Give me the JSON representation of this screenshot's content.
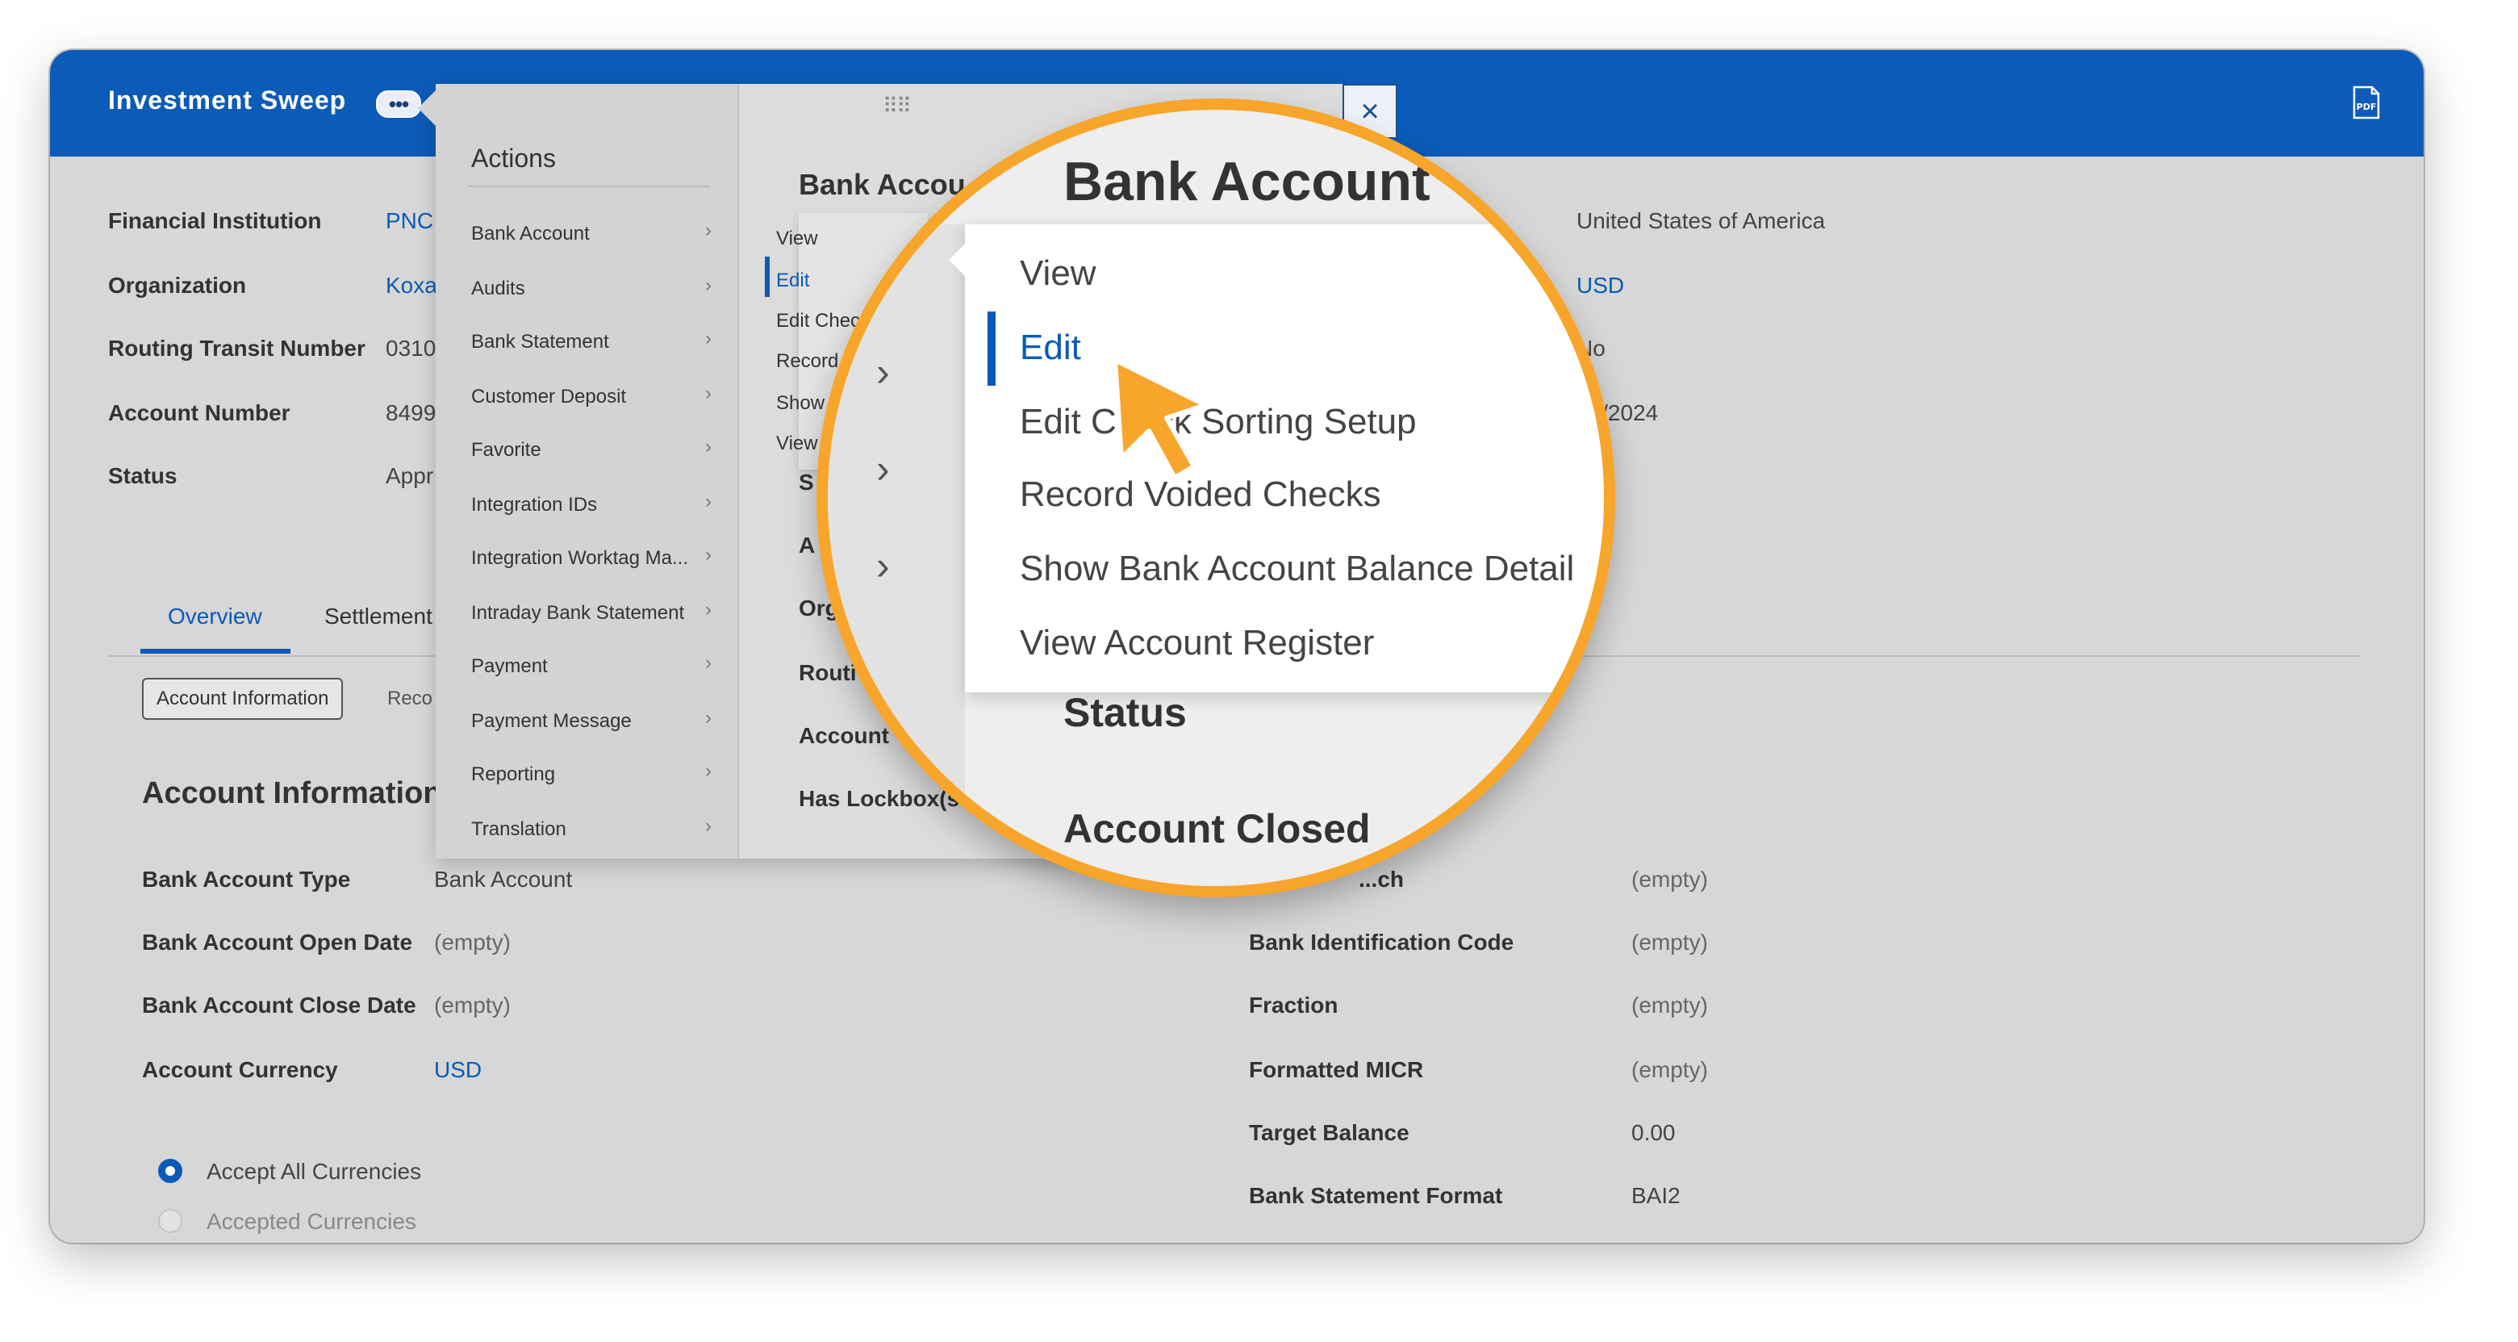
{
  "window": {
    "title": "Investment Sweep",
    "menu_dots": "•••",
    "pdf_icon": "pdf-icon"
  },
  "fields_left": [
    {
      "label": "Financial Institution",
      "value": "PNC",
      "link": true
    },
    {
      "label": "Organization",
      "value": "Koxa",
      "link": true
    },
    {
      "label": "Routing Transit Number",
      "value": "0310",
      "link": false
    },
    {
      "label": "Account Number",
      "value": "8499",
      "link": false
    },
    {
      "label": "Status",
      "value": "Appr",
      "link": false
    }
  ],
  "fields_right": [
    {
      "value": "United States of America",
      "link": false
    },
    {
      "value": "USD",
      "link": true
    },
    {
      "value": "No",
      "link": false
    },
    {
      "value": "08/2024",
      "link": false
    }
  ],
  "tabs": [
    {
      "label": "Overview",
      "active": true
    },
    {
      "label": "Settlement"
    }
  ],
  "subtabs": {
    "account_information": "Account Information",
    "reco": "Reco"
  },
  "section_title": "Account Information",
  "account_info_left": [
    {
      "label": "Bank Account Type",
      "value": "Bank Account",
      "link": false
    },
    {
      "label": "Bank Account Open Date",
      "value": "(empty)",
      "link": false
    },
    {
      "label": "Bank Account Close Date",
      "value": "(empty)",
      "link": false
    },
    {
      "label": "Account Currency",
      "value": "USD",
      "link": true
    }
  ],
  "account_info_right": [
    {
      "label": "...ch",
      "value": "(empty)"
    },
    {
      "label": "Bank Identification Code",
      "value": "(empty)"
    },
    {
      "label": "Fraction",
      "value": "(empty)"
    },
    {
      "label": "Formatted MICR",
      "value": "(empty)"
    },
    {
      "label": "Target Balance",
      "value": "0.00"
    },
    {
      "label": "Bank Statement Format",
      "value": "BAI2"
    }
  ],
  "currency_options": [
    {
      "label": "Accept All Currencies",
      "selected": true
    },
    {
      "label": "Accepted Currencies",
      "selected": false
    }
  ],
  "actions_menu": {
    "title": "Actions",
    "items": [
      "Bank Account",
      "Audits",
      "Bank Statement",
      "Customer Deposit",
      "Favorite",
      "Integration IDs",
      "Integration Worktag Ma...",
      "Intraday Bank Statement",
      "Payment",
      "Payment Message",
      "Reporting",
      "Translation"
    ]
  },
  "submenu_small": [
    "View",
    "Edit",
    "Edit Chec",
    "Record",
    "Show",
    "View"
  ],
  "popup_right": {
    "heading": "Bank Accou",
    "rows": [
      "S",
      "A",
      "Org",
      "Routi",
      "Account",
      "Has Lockbox(s"
    ]
  },
  "close_label": "×",
  "magnifier": {
    "heading": "Bank Account",
    "items": [
      "View",
      "Edit",
      "Edit Check Sorting Setup",
      "Record Voided Checks",
      "Show Bank Account Balance Detail",
      "View Account Register"
    ],
    "status_label": "Status",
    "account_closed_label": "Account Closed"
  },
  "colors": {
    "brand": "#0c5bb8",
    "link": "#0a5ab8",
    "highlight": "#f7a52b"
  }
}
